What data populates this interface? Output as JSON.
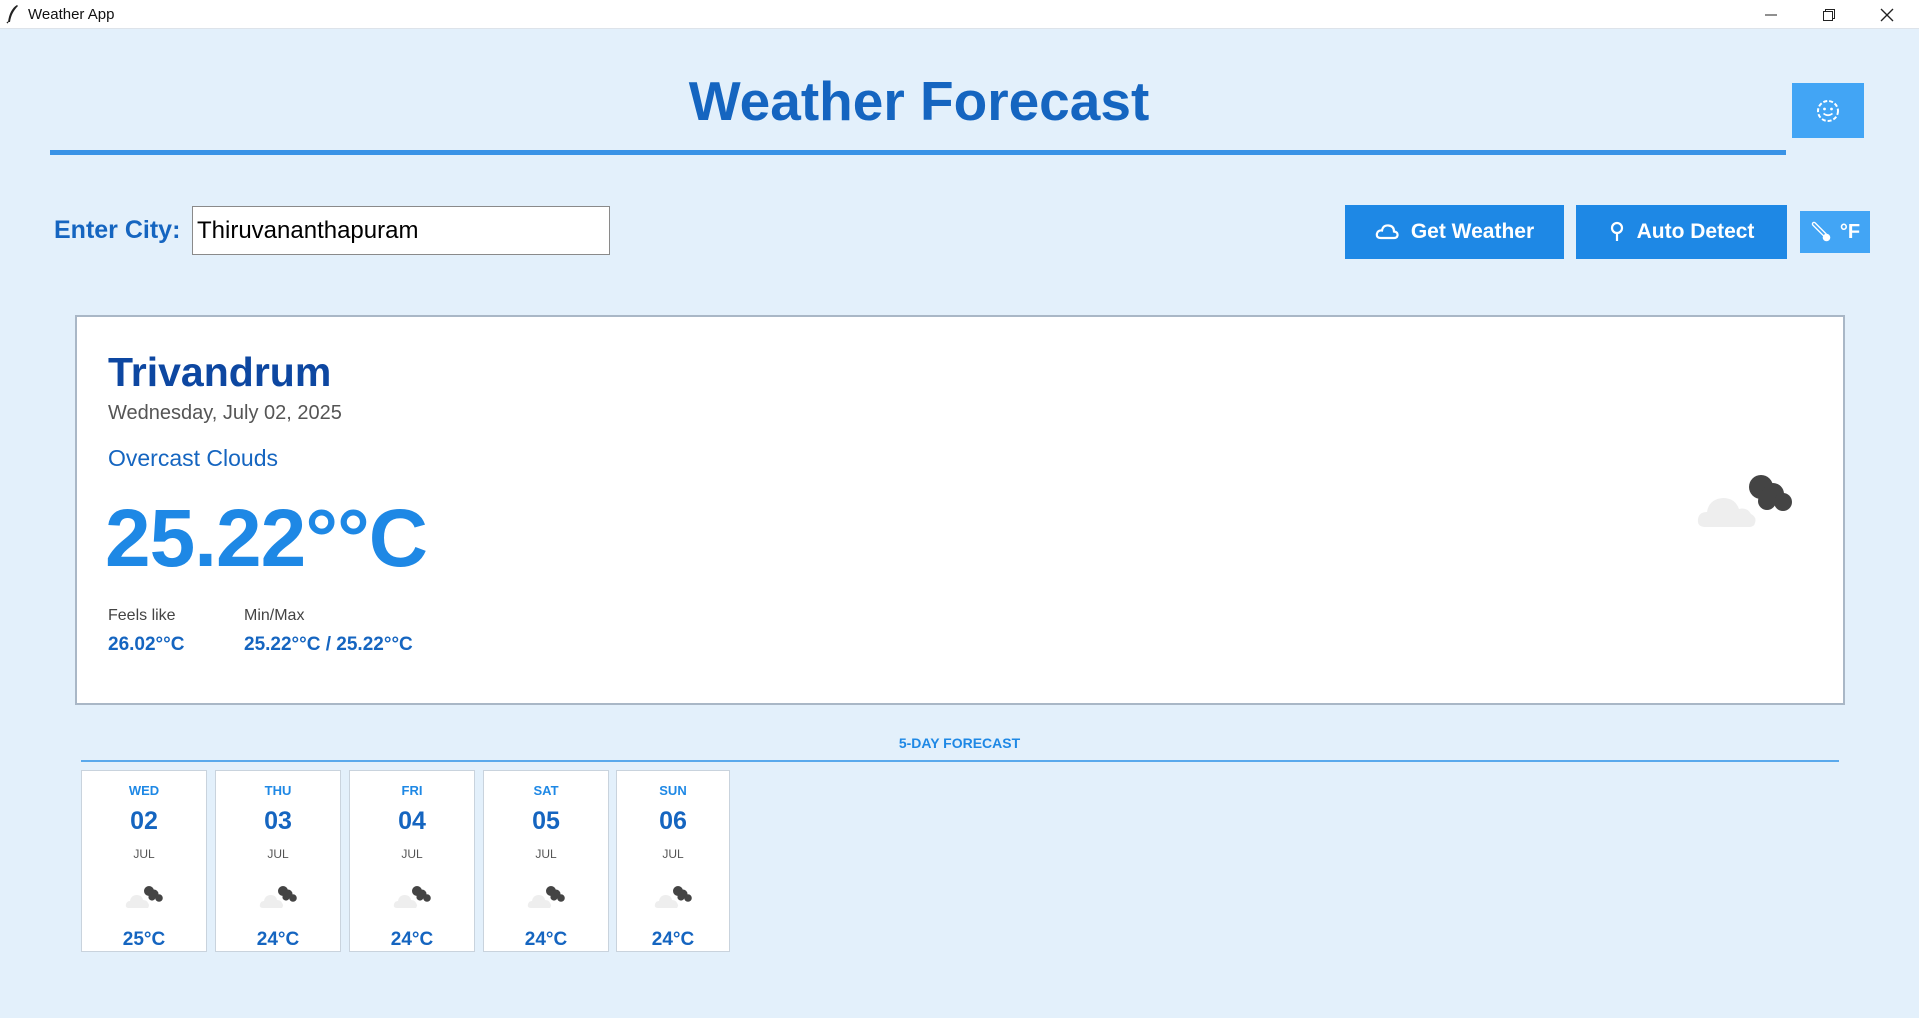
{
  "window": {
    "title": "Weather App"
  },
  "header": {
    "title": "Weather Forecast",
    "theme_toggle_icon": "smiley-icon"
  },
  "search": {
    "label": "Enter City:",
    "value": "Thiruvananthapuram",
    "get_weather_label": "Get Weather",
    "get_weather_icon": "cloud-icon",
    "auto_detect_label": "Auto Detect",
    "auto_detect_icon": "location-pin-icon",
    "unit_label": "°F",
    "unit_icon": "thermometer-icon"
  },
  "current": {
    "city": "Trivandrum",
    "date": "Wednesday, July 02, 2025",
    "description": "Overcast Clouds",
    "temperature": "25.22°°C",
    "feels_like_label": "Feels like",
    "feels_like_value": "26.02°°C",
    "minmax_label": "Min/Max",
    "minmax_value": "25.22°°C / 25.22°°C",
    "icon": "overcast-clouds-icon"
  },
  "forecast": {
    "title": "5-DAY FORECAST",
    "days": [
      {
        "day": "WED",
        "date": "02",
        "month": "JUL",
        "temp": "25°C",
        "icon": "overcast-clouds-icon"
      },
      {
        "day": "THU",
        "date": "03",
        "month": "JUL",
        "temp": "24°C",
        "icon": "overcast-clouds-icon"
      },
      {
        "day": "FRI",
        "date": "04",
        "month": "JUL",
        "temp": "24°C",
        "icon": "overcast-clouds-icon"
      },
      {
        "day": "SAT",
        "date": "05",
        "month": "JUL",
        "temp": "24°C",
        "icon": "overcast-clouds-icon"
      },
      {
        "day": "SUN",
        "date": "06",
        "month": "JUL",
        "temp": "24°C",
        "icon": "overcast-clouds-icon"
      }
    ]
  },
  "colors": {
    "background": "#e3f0fb",
    "accent": "#1e88e5",
    "title": "#1565c0",
    "dark_text": "#0d47a1"
  }
}
